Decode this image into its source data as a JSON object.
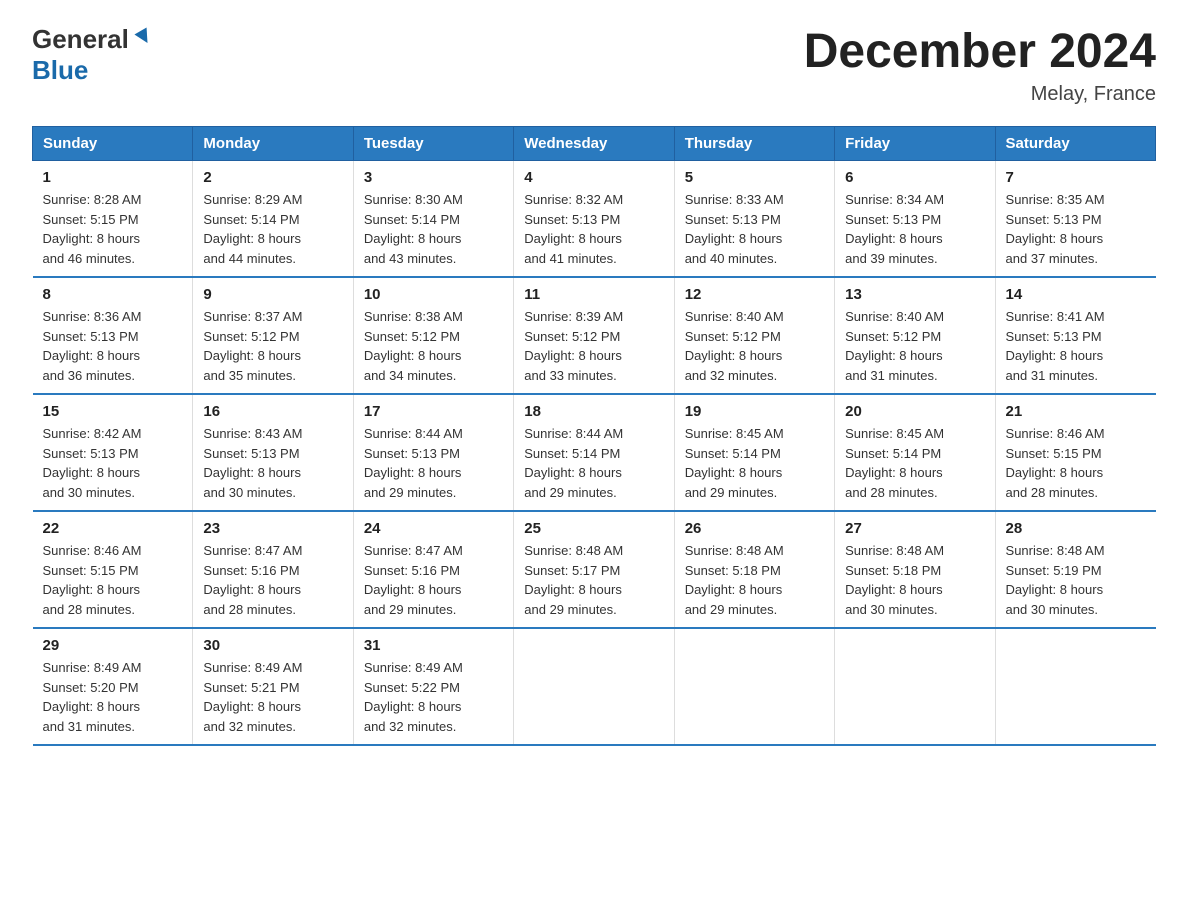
{
  "logo": {
    "general": "General",
    "blue": "Blue"
  },
  "header": {
    "title": "December 2024",
    "location": "Melay, France"
  },
  "days_of_week": [
    "Sunday",
    "Monday",
    "Tuesday",
    "Wednesday",
    "Thursday",
    "Friday",
    "Saturday"
  ],
  "weeks": [
    [
      {
        "day": "1",
        "sunrise": "8:28 AM",
        "sunset": "5:15 PM",
        "daylight": "8 hours and 46 minutes."
      },
      {
        "day": "2",
        "sunrise": "8:29 AM",
        "sunset": "5:14 PM",
        "daylight": "8 hours and 44 minutes."
      },
      {
        "day": "3",
        "sunrise": "8:30 AM",
        "sunset": "5:14 PM",
        "daylight": "8 hours and 43 minutes."
      },
      {
        "day": "4",
        "sunrise": "8:32 AM",
        "sunset": "5:13 PM",
        "daylight": "8 hours and 41 minutes."
      },
      {
        "day": "5",
        "sunrise": "8:33 AM",
        "sunset": "5:13 PM",
        "daylight": "8 hours and 40 minutes."
      },
      {
        "day": "6",
        "sunrise": "8:34 AM",
        "sunset": "5:13 PM",
        "daylight": "8 hours and 39 minutes."
      },
      {
        "day": "7",
        "sunrise": "8:35 AM",
        "sunset": "5:13 PM",
        "daylight": "8 hours and 37 minutes."
      }
    ],
    [
      {
        "day": "8",
        "sunrise": "8:36 AM",
        "sunset": "5:13 PM",
        "daylight": "8 hours and 36 minutes."
      },
      {
        "day": "9",
        "sunrise": "8:37 AM",
        "sunset": "5:12 PM",
        "daylight": "8 hours and 35 minutes."
      },
      {
        "day": "10",
        "sunrise": "8:38 AM",
        "sunset": "5:12 PM",
        "daylight": "8 hours and 34 minutes."
      },
      {
        "day": "11",
        "sunrise": "8:39 AM",
        "sunset": "5:12 PM",
        "daylight": "8 hours and 33 minutes."
      },
      {
        "day": "12",
        "sunrise": "8:40 AM",
        "sunset": "5:12 PM",
        "daylight": "8 hours and 32 minutes."
      },
      {
        "day": "13",
        "sunrise": "8:40 AM",
        "sunset": "5:12 PM",
        "daylight": "8 hours and 31 minutes."
      },
      {
        "day": "14",
        "sunrise": "8:41 AM",
        "sunset": "5:13 PM",
        "daylight": "8 hours and 31 minutes."
      }
    ],
    [
      {
        "day": "15",
        "sunrise": "8:42 AM",
        "sunset": "5:13 PM",
        "daylight": "8 hours and 30 minutes."
      },
      {
        "day": "16",
        "sunrise": "8:43 AM",
        "sunset": "5:13 PM",
        "daylight": "8 hours and 30 minutes."
      },
      {
        "day": "17",
        "sunrise": "8:44 AM",
        "sunset": "5:13 PM",
        "daylight": "8 hours and 29 minutes."
      },
      {
        "day": "18",
        "sunrise": "8:44 AM",
        "sunset": "5:14 PM",
        "daylight": "8 hours and 29 minutes."
      },
      {
        "day": "19",
        "sunrise": "8:45 AM",
        "sunset": "5:14 PM",
        "daylight": "8 hours and 29 minutes."
      },
      {
        "day": "20",
        "sunrise": "8:45 AM",
        "sunset": "5:14 PM",
        "daylight": "8 hours and 28 minutes."
      },
      {
        "day": "21",
        "sunrise": "8:46 AM",
        "sunset": "5:15 PM",
        "daylight": "8 hours and 28 minutes."
      }
    ],
    [
      {
        "day": "22",
        "sunrise": "8:46 AM",
        "sunset": "5:15 PM",
        "daylight": "8 hours and 28 minutes."
      },
      {
        "day": "23",
        "sunrise": "8:47 AM",
        "sunset": "5:16 PM",
        "daylight": "8 hours and 28 minutes."
      },
      {
        "day": "24",
        "sunrise": "8:47 AM",
        "sunset": "5:16 PM",
        "daylight": "8 hours and 29 minutes."
      },
      {
        "day": "25",
        "sunrise": "8:48 AM",
        "sunset": "5:17 PM",
        "daylight": "8 hours and 29 minutes."
      },
      {
        "day": "26",
        "sunrise": "8:48 AM",
        "sunset": "5:18 PM",
        "daylight": "8 hours and 29 minutes."
      },
      {
        "day": "27",
        "sunrise": "8:48 AM",
        "sunset": "5:18 PM",
        "daylight": "8 hours and 30 minutes."
      },
      {
        "day": "28",
        "sunrise": "8:48 AM",
        "sunset": "5:19 PM",
        "daylight": "8 hours and 30 minutes."
      }
    ],
    [
      {
        "day": "29",
        "sunrise": "8:49 AM",
        "sunset": "5:20 PM",
        "daylight": "8 hours and 31 minutes."
      },
      {
        "day": "30",
        "sunrise": "8:49 AM",
        "sunset": "5:21 PM",
        "daylight": "8 hours and 32 minutes."
      },
      {
        "day": "31",
        "sunrise": "8:49 AM",
        "sunset": "5:22 PM",
        "daylight": "8 hours and 32 minutes."
      },
      null,
      null,
      null,
      null
    ]
  ],
  "labels": {
    "sunrise": "Sunrise:",
    "sunset": "Sunset:",
    "daylight": "Daylight:"
  }
}
